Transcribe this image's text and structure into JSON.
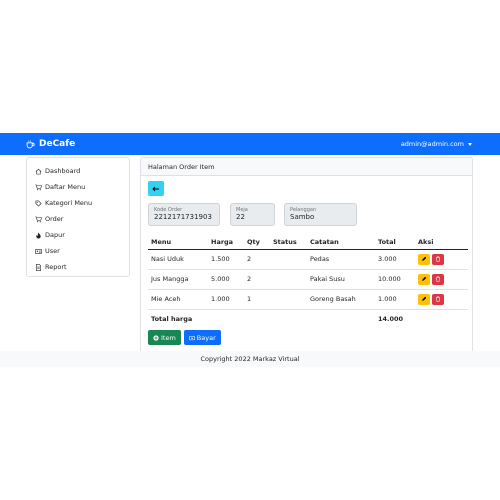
{
  "navbar": {
    "brand": "DeCafe",
    "user": "admin@admin.com"
  },
  "sidebar": {
    "items": [
      {
        "label": "Dashboard",
        "icon": "home-icon"
      },
      {
        "label": "Daftar Menu",
        "icon": "cart-icon"
      },
      {
        "label": "Kategori Menu",
        "icon": "tag-icon"
      },
      {
        "label": "Order",
        "icon": "cart-icon"
      },
      {
        "label": "Dapur",
        "icon": "fire-icon"
      },
      {
        "label": "User",
        "icon": "id-card-icon"
      },
      {
        "label": "Report",
        "icon": "document-icon"
      }
    ]
  },
  "card": {
    "header": "Halaman Order Item",
    "fields": {
      "kode": {
        "label": "Kode Order",
        "value": "2212171731903"
      },
      "meja": {
        "label": "Meja",
        "value": "22"
      },
      "pelanggan": {
        "label": "Pelanggan",
        "value": "Sambo"
      }
    },
    "table": {
      "headers": [
        "Menu",
        "Harga",
        "Qty",
        "Status",
        "Catatan",
        "Total",
        "Aksi"
      ],
      "rows": [
        {
          "menu": "Nasi Uduk",
          "harga": "1.500",
          "qty": "2",
          "status": "",
          "catatan": "Pedas",
          "total": "3.000"
        },
        {
          "menu": "Jus Mangga",
          "harga": "5.000",
          "qty": "2",
          "status": "",
          "catatan": "Pakai Susu",
          "total": "10.000"
        },
        {
          "menu": "Mie Aceh",
          "harga": "1.000",
          "qty": "1",
          "status": "",
          "catatan": "Goreng Basah",
          "total": "1.000"
        }
      ],
      "total_label": "Total harga",
      "total_value": "14.000"
    },
    "buttons": {
      "item": "Item",
      "bayar": "Bayar"
    }
  },
  "footer": {
    "text": "Copyright 2022 Markaz Virtual"
  },
  "colors": {
    "primary": "#0d6efd",
    "info": "#31d2f2",
    "warning": "#ffc107",
    "danger": "#dc3545",
    "success": "#198754"
  }
}
